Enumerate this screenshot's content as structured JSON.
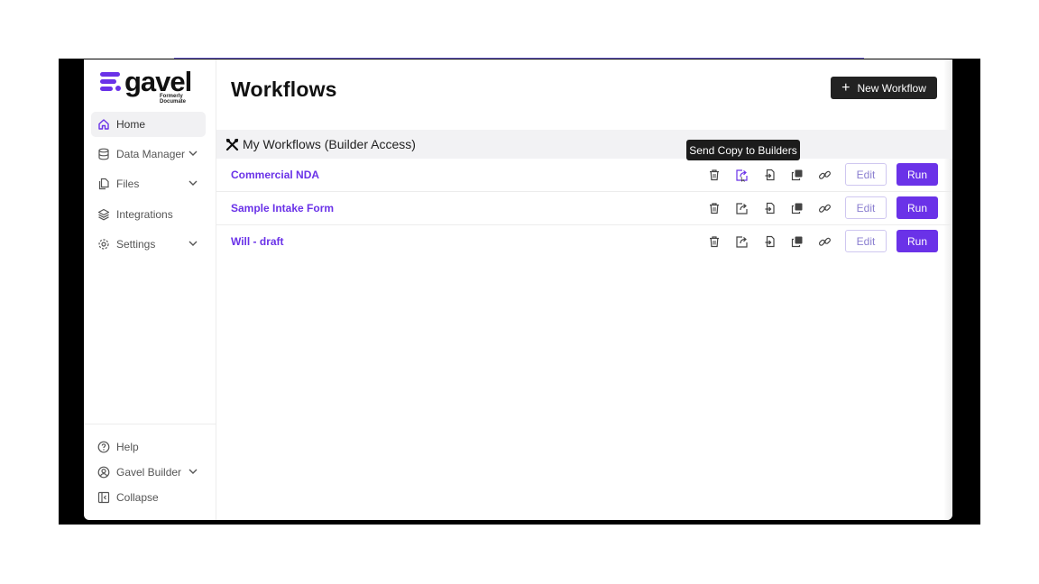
{
  "brand": {
    "name": "gavel",
    "tagline": "Formerly Documate",
    "accent": "#6a32e8"
  },
  "sidebar": {
    "items": [
      {
        "label": "Home",
        "icon": "home-icon",
        "active": true,
        "expandable": false
      },
      {
        "label": "Data Manager",
        "icon": "database-icon",
        "active": false,
        "expandable": true
      },
      {
        "label": "Files",
        "icon": "files-icon",
        "active": false,
        "expandable": true
      },
      {
        "label": "Integrations",
        "icon": "layers-icon",
        "active": false,
        "expandable": false
      },
      {
        "label": "Settings",
        "icon": "gear-icon",
        "active": false,
        "expandable": true
      }
    ],
    "footer": [
      {
        "label": "Help",
        "icon": "help-icon",
        "expandable": false
      },
      {
        "label": "Gavel Builder",
        "icon": "user-icon",
        "expandable": true
      },
      {
        "label": "Collapse",
        "icon": "collapse-icon",
        "expandable": false
      }
    ]
  },
  "main": {
    "title": "Workflows",
    "new_button_label": "New Workflow",
    "section_title": "My Workflows (Builder Access)",
    "tooltip": "Send Copy to Builders",
    "edit_label": "Edit",
    "run_label": "Run",
    "workflows": [
      {
        "name": "Commercial NDA"
      },
      {
        "name": "Sample Intake Form"
      },
      {
        "name": "Will - draft"
      }
    ]
  }
}
